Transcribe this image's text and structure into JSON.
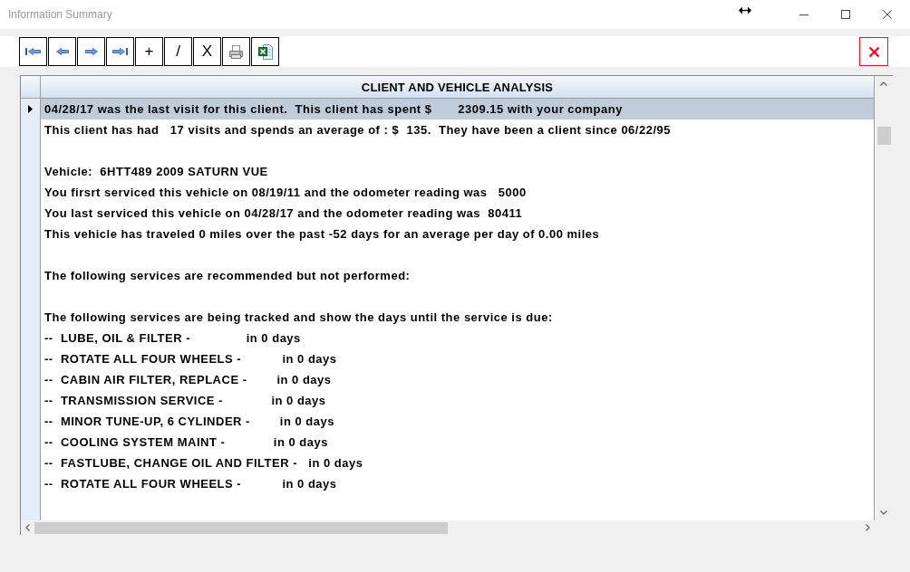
{
  "window": {
    "title": "Information Summary"
  },
  "toolbar": {
    "buttons": [
      {
        "kind": "first"
      },
      {
        "kind": "previous"
      },
      {
        "kind": "next"
      },
      {
        "kind": "last"
      },
      {
        "kind": "add",
        "label": "+"
      },
      {
        "kind": "edit",
        "label": "/"
      },
      {
        "kind": "delete",
        "label": "X"
      },
      {
        "kind": "print"
      },
      {
        "kind": "spreadsheet"
      }
    ]
  },
  "grid": {
    "column_header": "CLIENT AND VEHICLE ANALYSIS",
    "rows": [
      {
        "text": "04/28/17 was the last visit for this client.  This client has spent $       2309.15 with your company",
        "selected": true
      },
      {
        "text": "This client has had   17 visits and spends an average of : $  135.  They have been a client since 06/22/95",
        "selected": false
      },
      {
        "selected": false
      },
      {
        "text": "Vehicle:  6HTT489 2009 SATURN VUE",
        "selected": false
      },
      {
        "text": "You firsrt serviced this vehicle on 08/19/11 and the odometer reading was   5000",
        "selected": false
      },
      {
        "text": "You last serviced this vehicle on 04/28/17 and the odometer reading was  80411",
        "selected": false
      },
      {
        "text": "This vehicle has traveled 0 miles over the past -52 days for an average per day of 0.00 miles",
        "selected": false
      },
      {
        "selected": false
      },
      {
        "text": "The following services are recommended but not performed:",
        "selected": false
      },
      {
        "selected": false
      },
      {
        "text": "The following services are being tracked and show the days until the service is due:",
        "selected": false
      },
      {
        "text": "--  LUBE, OIL & FILTER -               in 0 days",
        "selected": false
      },
      {
        "text": "--  ROTATE ALL FOUR WHEELS -           in 0 days",
        "selected": false
      },
      {
        "text": "--  CABIN AIR FILTER, REPLACE -        in 0 days",
        "selected": false
      },
      {
        "text": "--  TRANSMISSION SERVICE -             in 0 days",
        "selected": false
      },
      {
        "text": "--  MINOR TUNE-UP, 6 CYLINDER -        in 0 days",
        "selected": false
      },
      {
        "text": "--  COOLING SYSTEM MAINT -             in 0 days",
        "selected": false
      },
      {
        "text": "--  FASTLUBE, CHANGE OIL AND FILTER -   in 0 days",
        "selected": false
      },
      {
        "text": "--  ROTATE ALL FOUR WHEELS -           in 0 days",
        "selected": false
      }
    ]
  }
}
